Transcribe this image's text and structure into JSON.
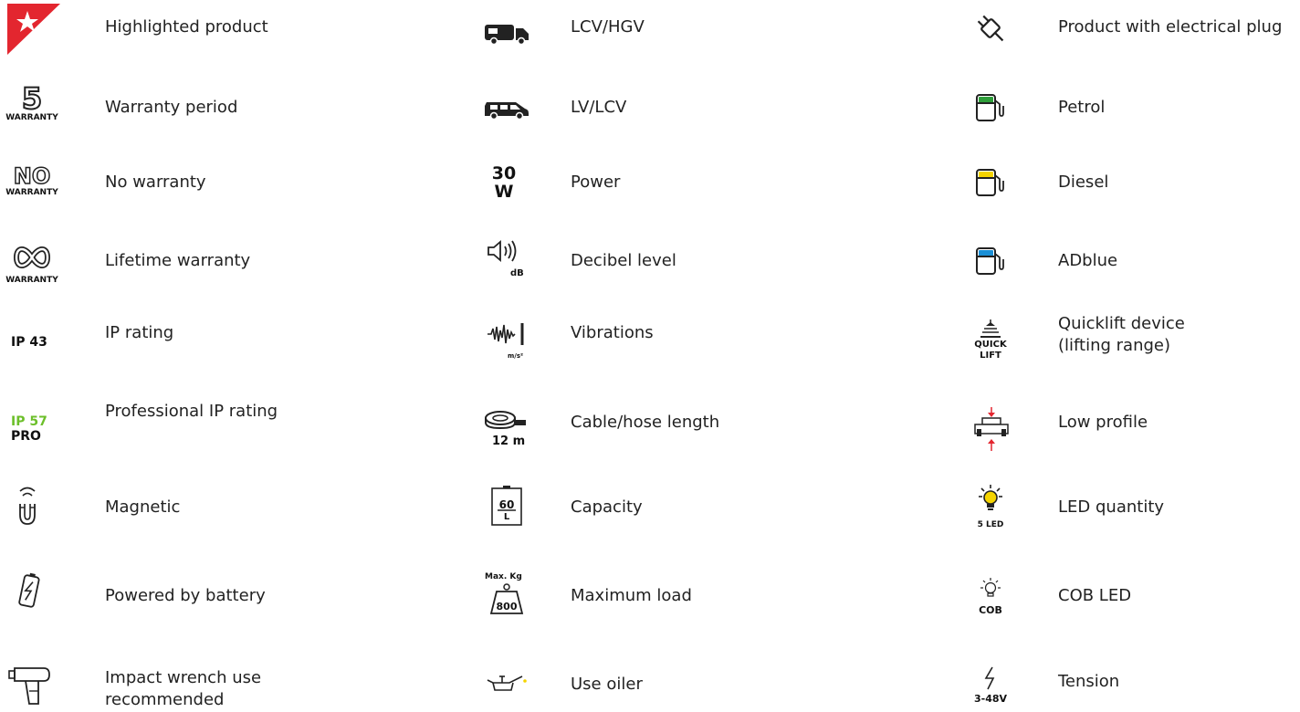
{
  "legend": {
    "col1": [
      {
        "icon": "highlight-star-icon",
        "label": "Highlighted product"
      },
      {
        "icon": "warranty-5-icon",
        "label": "Warranty period",
        "badge_main": "5",
        "badge_sub": "WARRANTY"
      },
      {
        "icon": "no-warranty-icon",
        "label": "No warranty",
        "badge_main": "NO",
        "badge_sub": "WARRANTY"
      },
      {
        "icon": "lifetime-warranty-icon",
        "label": "Lifetime warranty",
        "badge_sub": "WARRANTY"
      },
      {
        "icon": "ip-rating-icon",
        "label": "IP rating",
        "badge_main": "IP 43"
      },
      {
        "icon": "pro-ip-rating-icon",
        "label": "Professional IP rating",
        "badge_main": "IP 57",
        "badge_sub": "PRO"
      },
      {
        "icon": "magnetic-icon",
        "label": "Magnetic"
      },
      {
        "icon": "battery-icon",
        "label": "Powered by battery"
      },
      {
        "icon": "impact-wrench-icon",
        "label": "Impact wrench use recommended",
        "label_line1": "Impact wrench use",
        "label_line2": "recommended"
      }
    ],
    "col2": [
      {
        "icon": "truck-icon",
        "label": "LCV/HGV"
      },
      {
        "icon": "van-icon",
        "label": "LV/LCV"
      },
      {
        "icon": "power-icon",
        "label": "Power",
        "badge_main": "30",
        "badge_sub": "W"
      },
      {
        "icon": "speaker-icon",
        "label": "Decibel level",
        "badge_sub": "dB"
      },
      {
        "icon": "vibration-icon",
        "label": "Vibrations",
        "badge_sub": "m/s²"
      },
      {
        "icon": "tape-measure-icon",
        "label": "Cable/hose length",
        "badge_sub": "12 m"
      },
      {
        "icon": "capacity-icon",
        "label": "Capacity",
        "badge_main": "60",
        "badge_sub": "L"
      },
      {
        "icon": "weight-icon",
        "label": "Maximum load",
        "badge_main": "Max. Kg",
        "badge_sub": "800"
      },
      {
        "icon": "oiler-icon",
        "label": "Use oiler"
      }
    ],
    "col3": [
      {
        "icon": "electrical-plug-icon",
        "label": "Product with electrical plug"
      },
      {
        "icon": "fuel-petrol-icon",
        "label": "Petrol",
        "color": "#2e9e3a"
      },
      {
        "icon": "fuel-diesel-icon",
        "label": "Diesel",
        "color": "#f5d400"
      },
      {
        "icon": "fuel-adblue-icon",
        "label": "ADblue",
        "color": "#1a8fd6"
      },
      {
        "icon": "quicklift-icon",
        "label": "Quicklift device (lifting range)",
        "label_line1": "Quicklift device",
        "label_line2": "(lifting range)",
        "badge_main": "QUICK",
        "badge_sub": "LIFT"
      },
      {
        "icon": "low-profile-icon",
        "label": "Low profile"
      },
      {
        "icon": "led-bulb-icon",
        "label": "LED quantity",
        "badge_sub": "5 LED",
        "color": "#f5d400"
      },
      {
        "icon": "cob-led-icon",
        "label": "COB LED",
        "badge_sub": "COB"
      },
      {
        "icon": "tension-icon",
        "label": "Tension",
        "badge_sub": "3-48V"
      }
    ]
  },
  "colors": {
    "accent_red": "#e3262f",
    "pro_green": "#6cbf2a",
    "text": "#222222"
  }
}
